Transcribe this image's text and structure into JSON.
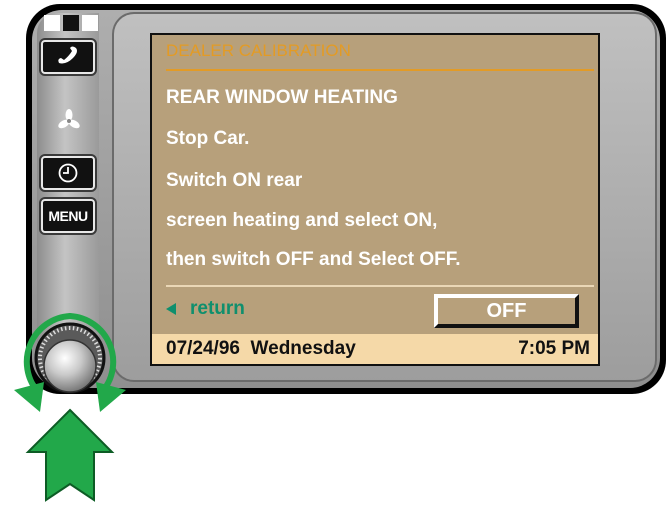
{
  "indicators": [
    "white",
    "black",
    "white"
  ],
  "side_buttons": {
    "phone_icon": "phone-icon",
    "fan_icon": "fan-icon",
    "clock_icon": "clock-icon",
    "menu_label": "MENU"
  },
  "screen": {
    "title": "DEALER CALIBRATION",
    "lines": [
      "REAR WINDOW HEATING",
      "Stop Car.",
      "Switch ON rear",
      "screen heating and select ON,",
      "then switch OFF and Select OFF."
    ],
    "return_label": "return",
    "off_button_label": "OFF",
    "status_date": "07/24/96",
    "status_day": "Wednesday",
    "status_time": "7:05 PM"
  },
  "colors": {
    "screen_bg": "#b7a07b",
    "title": "#e39b25",
    "return": "#0f8f6d",
    "status_bar": "#f5d9a8",
    "arrow_green": "#22a84a"
  }
}
